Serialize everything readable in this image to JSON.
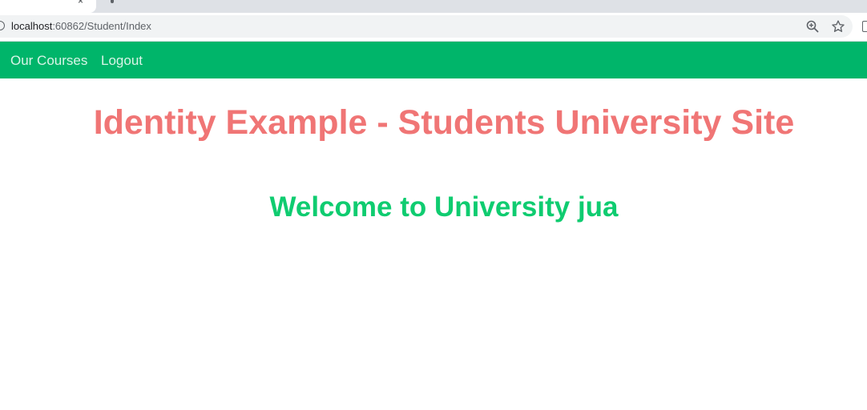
{
  "browser": {
    "tab_close_glyph": "×",
    "url_host": "localhost",
    "url_rest": ":60862/Student/Index",
    "icons": [
      "info-icon",
      "zoom-icon",
      "star-icon"
    ]
  },
  "navbar": {
    "background": "#00b56a",
    "links": [
      {
        "label": "Our Courses"
      },
      {
        "label": "Logout"
      }
    ]
  },
  "main": {
    "title": "Identity Example - Students University Site",
    "title_color": "#f07575",
    "welcome": "Welcome to University jua",
    "welcome_color": "#0fcc70"
  }
}
